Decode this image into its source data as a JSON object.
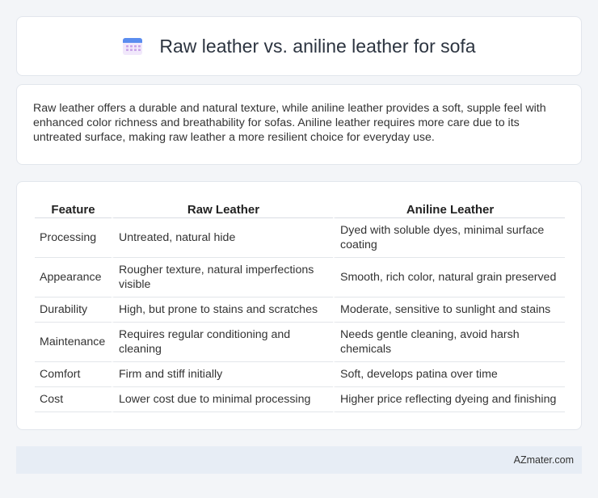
{
  "header": {
    "title": "Raw leather vs. aniline leather for sofa",
    "icon": "calendar-icon",
    "icon_colors": {
      "top": "#5b8def",
      "grid": "#c9a3e8"
    }
  },
  "summary": {
    "text": "Raw leather offers a durable and natural texture, while aniline leather provides a soft, supple feel with enhanced color richness and breathability for sofas. Aniline leather requires more care due to its untreated surface, making raw leather a more resilient choice for everyday use."
  },
  "table": {
    "headers": [
      "Feature",
      "Raw Leather",
      "Aniline Leather"
    ],
    "rows": [
      [
        "Processing",
        "Untreated, natural hide",
        "Dyed with soluble dyes, minimal surface coating"
      ],
      [
        "Appearance",
        "Rougher texture, natural imperfections visible",
        "Smooth, rich color, natural grain preserved"
      ],
      [
        "Durability",
        "High, but prone to stains and scratches",
        "Moderate, sensitive to sunlight and stains"
      ],
      [
        "Maintenance",
        "Requires regular conditioning and cleaning",
        "Needs gentle cleaning, avoid harsh chemicals"
      ],
      [
        "Comfort",
        "Firm and stiff initially",
        "Soft, develops patina over time"
      ],
      [
        "Cost",
        "Lower cost due to minimal processing",
        "Higher price reflecting dyeing and finishing"
      ]
    ]
  },
  "footer": {
    "text": "AZmater.com"
  }
}
